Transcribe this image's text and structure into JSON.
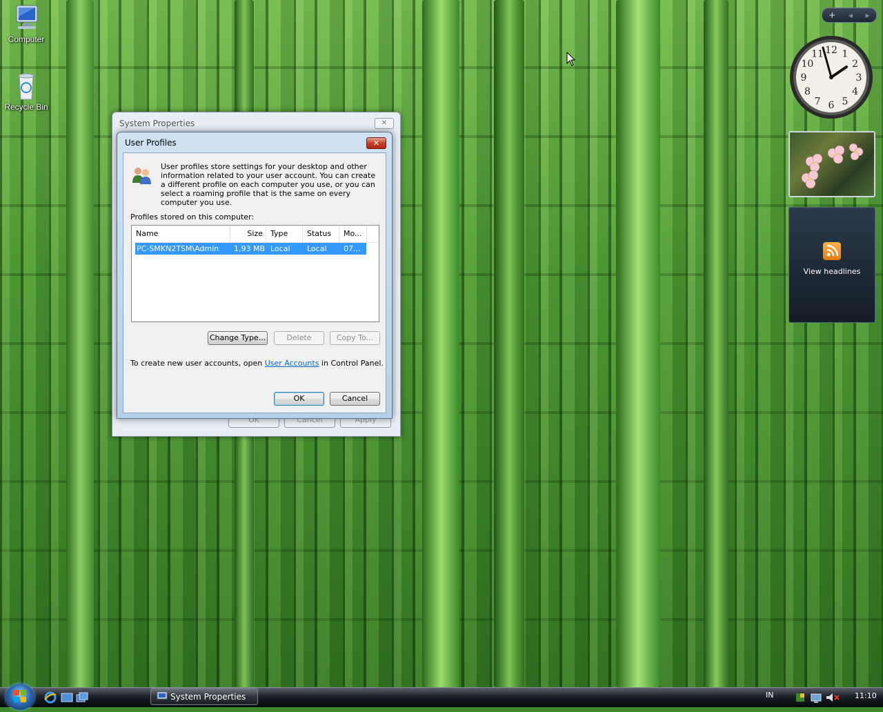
{
  "desktop": {
    "icons": [
      {
        "label": "Computer"
      },
      {
        "label": "Recycle Bin"
      }
    ]
  },
  "sidebar": {
    "controls": {
      "add": "+",
      "prev": "◀",
      "next": "▶"
    },
    "clock": {
      "numerals": [
        "12",
        "1",
        "2",
        "3",
        "4",
        "5",
        "6",
        "7",
        "8",
        "9",
        "10",
        "11"
      ]
    },
    "feed": {
      "label": "View headlines"
    }
  },
  "system_properties": {
    "title": "System Properties",
    "buttons": {
      "ok": "OK",
      "cancel": "Cancel",
      "apply": "Apply"
    }
  },
  "user_profiles": {
    "title": "User Profiles",
    "intro": "User profiles store settings for your desktop and other information related to your user account. You can create a different profile on each computer you use, or you can select a roaming profile that is the same on every computer you use.",
    "list_label": "Profiles stored on this computer:",
    "columns": [
      "Name",
      "Size",
      "Type",
      "Status",
      "Mo..."
    ],
    "rows": [
      {
        "name": "PC-SMKN2TSM\\Admin",
        "size": "1,93 MB",
        "type": "Local",
        "status": "Local",
        "modified": "07..."
      }
    ],
    "buttons": {
      "change_type": "Change Type...",
      "delete": "Delete",
      "copy_to": "Copy To...",
      "ok": "OK",
      "cancel": "Cancel"
    },
    "hint_prefix": "To create new user accounts, open ",
    "hint_link": "User Accounts",
    "hint_suffix": " in Control Panel."
  },
  "taskbar": {
    "task_button": "System Properties",
    "language": "IN",
    "time": "11:10"
  }
}
